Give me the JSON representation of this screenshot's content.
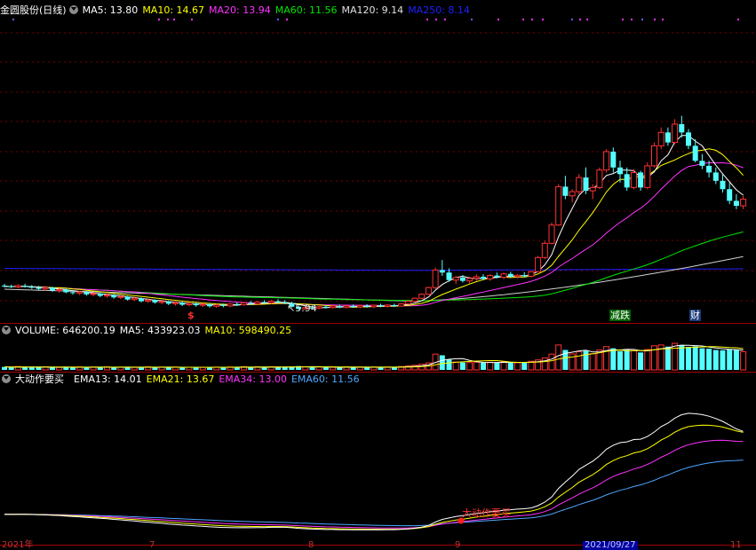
{
  "header": {
    "stock_title": "金圆股份(日线)",
    "ma": [
      {
        "label": "MA5: 13.80",
        "color": "#ffffff"
      },
      {
        "label": "MA10: 14.67",
        "color": "#ffff00"
      },
      {
        "label": "MA20: 13.94",
        "color": "#ff33ff"
      },
      {
        "label": "MA60: 11.56",
        "color": "#00e600"
      },
      {
        "label": "MA120: 9.14",
        "color": "#e0e0e0"
      },
      {
        "label": "MA250: 8.14",
        "color": "#2020ff"
      }
    ]
  },
  "volume_header": {
    "items": [
      {
        "label": "VOLUME: 646200.19",
        "color": "#ffffff"
      },
      {
        "label": "MA5: 433923.03",
        "color": "#ffffff"
      },
      {
        "label": "MA10: 598490.25",
        "color": "#ffff00"
      }
    ]
  },
  "indicator_header": {
    "name": "大动作要买",
    "items": [
      {
        "label": "EMA13: 14.01",
        "color": "#ffffff"
      },
      {
        "label": "EMA21: 13.67",
        "color": "#ffff00"
      },
      {
        "label": "EMA34: 13.00",
        "color": "#ff33ff"
      },
      {
        "label": "EMA60: 11.56",
        "color": "#4da6ff"
      }
    ]
  },
  "annotations": {
    "low_price": "5.94",
    "marker_s": "$",
    "tag_jd": "减跌",
    "tag_cai": "财",
    "buy_signal": "大动作要买"
  },
  "axis_dates": [
    "2021年",
    "7",
    "8",
    "9",
    "2021/09/27",
    "11"
  ],
  "colors": {
    "up": "#ff3232",
    "down": "#54ffff",
    "bg": "#000000",
    "grid": "#7a0000"
  },
  "chart_data": {
    "type": "candlestick",
    "title": "金圆股份(日线)",
    "low_marker": 5.94,
    "candles": [
      [
        7.42,
        7.53,
        7.31,
        7.38
      ],
      [
        7.38,
        7.47,
        7.28,
        7.33
      ],
      [
        7.33,
        7.5,
        7.25,
        7.41
      ],
      [
        7.41,
        7.53,
        7.3,
        7.35
      ],
      [
        7.35,
        7.45,
        7.22,
        7.29
      ],
      [
        7.29,
        7.4,
        7.14,
        7.22
      ],
      [
        7.22,
        7.39,
        7.1,
        7.3
      ],
      [
        7.3,
        7.35,
        7.05,
        7.12
      ],
      [
        7.12,
        7.26,
        6.99,
        7.18
      ],
      [
        7.18,
        7.24,
        6.96,
        7.02
      ],
      [
        7.02,
        7.13,
        6.88,
        6.97
      ],
      [
        6.97,
        7.1,
        6.85,
        7.04
      ],
      [
        7.04,
        7.09,
        6.81,
        6.89
      ],
      [
        6.89,
        7.02,
        6.78,
        6.94
      ],
      [
        6.94,
        7.0,
        6.72,
        6.8
      ],
      [
        6.8,
        6.93,
        6.69,
        6.85
      ],
      [
        6.85,
        6.92,
        6.63,
        6.71
      ],
      [
        6.71,
        6.84,
        6.6,
        6.76
      ],
      [
        6.76,
        6.8,
        6.52,
        6.58
      ],
      [
        6.58,
        6.74,
        6.49,
        6.66
      ],
      [
        6.66,
        6.71,
        6.41,
        6.48
      ],
      [
        6.48,
        6.62,
        6.38,
        6.55
      ],
      [
        6.55,
        6.6,
        6.33,
        6.41
      ],
      [
        6.41,
        6.55,
        6.3,
        6.47
      ],
      [
        6.47,
        6.52,
        6.25,
        6.33
      ],
      [
        6.33,
        6.48,
        6.22,
        6.4
      ],
      [
        6.4,
        6.46,
        6.19,
        6.27
      ],
      [
        6.27,
        6.41,
        6.18,
        6.35
      ],
      [
        6.35,
        6.42,
        6.15,
        6.24
      ],
      [
        6.24,
        6.38,
        6.13,
        6.3
      ],
      [
        6.3,
        6.37,
        6.1,
        6.18
      ],
      [
        6.18,
        6.32,
        6.08,
        6.26
      ],
      [
        6.26,
        6.34,
        6.12,
        6.2
      ],
      [
        6.2,
        6.37,
        6.12,
        6.31
      ],
      [
        6.31,
        6.41,
        6.2,
        6.27
      ],
      [
        6.27,
        6.44,
        6.21,
        6.38
      ],
      [
        6.38,
        6.5,
        6.28,
        6.33
      ],
      [
        6.33,
        6.49,
        6.25,
        6.43
      ],
      [
        6.43,
        6.55,
        6.34,
        6.39
      ],
      [
        6.39,
        6.56,
        6.3,
        6.48
      ],
      [
        6.48,
        6.6,
        6.37,
        6.41
      ],
      [
        6.41,
        6.55,
        6.3,
        6.36
      ],
      [
        6.36,
        6.45,
        6.1,
        6.15
      ],
      [
        6.15,
        6.27,
        5.94,
        6.02
      ],
      [
        6.02,
        6.18,
        5.97,
        6.1
      ],
      [
        6.1,
        6.22,
        6.0,
        6.07
      ],
      [
        6.07,
        6.2,
        6.0,
        6.15
      ],
      [
        6.15,
        6.24,
        6.05,
        6.1
      ],
      [
        6.1,
        6.25,
        6.03,
        6.19
      ],
      [
        6.19,
        6.28,
        6.06,
        6.12
      ],
      [
        6.12,
        6.26,
        6.05,
        6.2
      ],
      [
        6.2,
        6.29,
        6.08,
        6.14
      ],
      [
        6.14,
        6.27,
        6.06,
        6.22
      ],
      [
        6.22,
        6.3,
        6.09,
        6.15
      ],
      [
        6.15,
        6.28,
        6.07,
        6.24
      ],
      [
        6.24,
        6.33,
        6.12,
        6.17
      ],
      [
        6.17,
        6.3,
        6.1,
        6.25
      ],
      [
        6.25,
        6.34,
        6.13,
        6.19
      ],
      [
        6.19,
        6.37,
        6.14,
        6.32
      ],
      [
        6.32,
        6.52,
        6.28,
        6.48
      ],
      [
        6.48,
        6.7,
        6.42,
        6.66
      ],
      [
        6.66,
        6.95,
        6.6,
        6.9
      ],
      [
        6.9,
        7.35,
        6.85,
        7.3
      ],
      [
        7.3,
        8.5,
        7.2,
        8.35
      ],
      [
        8.35,
        8.95,
        8.0,
        8.2
      ],
      [
        8.2,
        8.45,
        7.65,
        7.75
      ],
      [
        7.75,
        8.0,
        7.5,
        7.9
      ],
      [
        7.9,
        8.05,
        7.6,
        7.7
      ],
      [
        7.7,
        7.95,
        7.55,
        7.85
      ],
      [
        7.85,
        8.1,
        7.7,
        7.95
      ],
      [
        7.95,
        8.1,
        7.75,
        7.82
      ],
      [
        7.82,
        8.1,
        7.7,
        8.02
      ],
      [
        8.02,
        8.2,
        7.85,
        7.92
      ],
      [
        7.92,
        8.2,
        7.8,
        8.12
      ],
      [
        8.12,
        8.25,
        7.88,
        7.96
      ],
      [
        7.96,
        8.1,
        7.85,
        8.04
      ],
      [
        8.04,
        8.22,
        7.9,
        7.98
      ],
      [
        7.98,
        8.3,
        7.92,
        8.25
      ],
      [
        8.25,
        9.2,
        8.2,
        9.1
      ],
      [
        9.1,
        10.1,
        9.0,
        9.95
      ],
      [
        9.95,
        11.2,
        9.9,
        11.05
      ],
      [
        11.05,
        13.5,
        11.0,
        13.35
      ],
      [
        13.35,
        14.0,
        12.6,
        12.8
      ],
      [
        12.8,
        13.2,
        12.4,
        13.05
      ],
      [
        13.05,
        14.1,
        12.9,
        13.9
      ],
      [
        13.9,
        14.5,
        12.9,
        13.1
      ],
      [
        13.1,
        13.5,
        12.6,
        13.3
      ],
      [
        13.3,
        14.5,
        13.2,
        14.35
      ],
      [
        14.35,
        15.6,
        14.2,
        15.45
      ],
      [
        15.45,
        15.7,
        14.2,
        14.5
      ],
      [
        14.5,
        14.9,
        13.6,
        14.1
      ],
      [
        14.1,
        14.5,
        13.1,
        13.3
      ],
      [
        13.3,
        14.4,
        13.2,
        14.2
      ],
      [
        14.2,
        14.3,
        13.1,
        13.3
      ],
      [
        13.3,
        14.8,
        13.2,
        14.6
      ],
      [
        14.6,
        16.0,
        14.5,
        15.8
      ],
      [
        15.8,
        16.9,
        15.6,
        16.6
      ],
      [
        16.6,
        16.9,
        15.8,
        16.0
      ],
      [
        16.0,
        17.4,
        15.9,
        17.1
      ],
      [
        17.1,
        17.6,
        16.3,
        16.6
      ],
      [
        16.6,
        16.8,
        15.6,
        15.8
      ],
      [
        15.8,
        16.2,
        14.8,
        14.9
      ],
      [
        14.9,
        15.3,
        14.4,
        14.6
      ],
      [
        14.6,
        14.9,
        13.9,
        14.2
      ],
      [
        14.2,
        14.5,
        13.5,
        13.7
      ],
      [
        13.7,
        14.1,
        13.0,
        13.2
      ],
      [
        13.2,
        13.6,
        12.3,
        12.5
      ],
      [
        12.5,
        12.9,
        12.0,
        12.2
      ],
      [
        12.2,
        12.8,
        12.0,
        12.6
      ]
    ],
    "volume": [
      18,
      17,
      20,
      16,
      15,
      17,
      18,
      16,
      15,
      17,
      16,
      18,
      15,
      17,
      16,
      18,
      15,
      16,
      17,
      15,
      16,
      18,
      15,
      17,
      16,
      17,
      15,
      16,
      17,
      15,
      16,
      17,
      15,
      18,
      16,
      19,
      16,
      18,
      17,
      18,
      16,
      17,
      20,
      23,
      18,
      17,
      18,
      16,
      17,
      16,
      17,
      16,
      17,
      16,
      17,
      16,
      17,
      18,
      20,
      24,
      28,
      34,
      42,
      95,
      88,
      62,
      48,
      45,
      44,
      47,
      43,
      46,
      44,
      48,
      45,
      43,
      47,
      52,
      60,
      72,
      95,
      150,
      120,
      96,
      110,
      115,
      98,
      120,
      140,
      130,
      112,
      120,
      115,
      105,
      122,
      145,
      150,
      140,
      160,
      150,
      138,
      142,
      130,
      128,
      120,
      118,
      125,
      120,
      110
    ],
    "ma_lines": [
      "MA5",
      "MA10",
      "MA20",
      "MA60",
      "MA120",
      "MA250"
    ],
    "indicator": {
      "name": "大动作要买",
      "series": [
        "EMA13",
        "EMA21",
        "EMA34",
        "EMA60"
      ]
    },
    "ylim_price": [
      5.5,
      18.0
    ]
  }
}
